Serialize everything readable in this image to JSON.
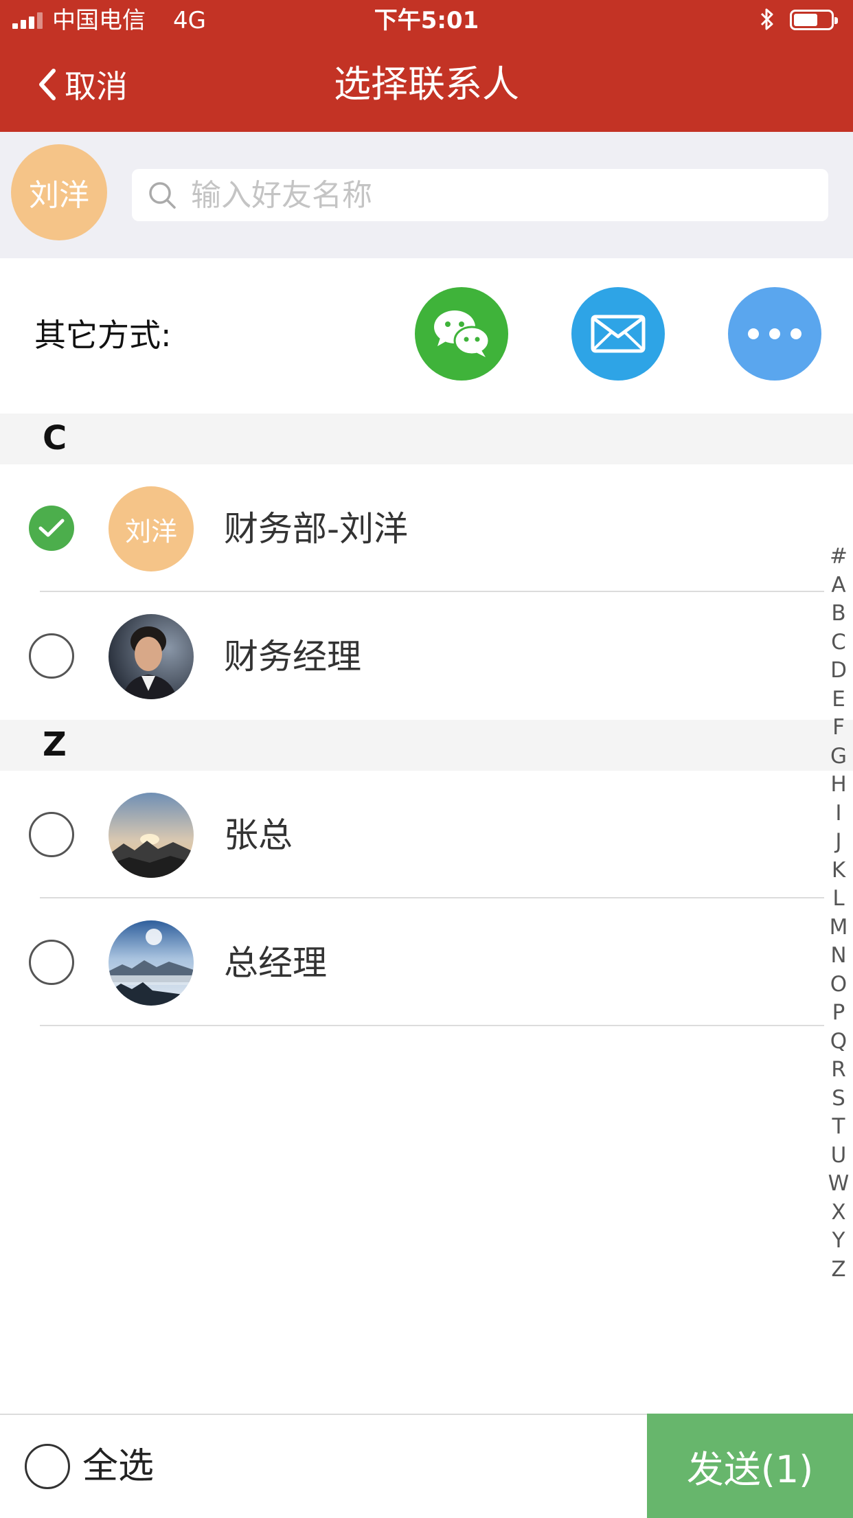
{
  "status_bar": {
    "carrier": "中国电信",
    "network": "4G",
    "time": "下午5:01"
  },
  "nav": {
    "back_label": "取消",
    "title": "选择联系人"
  },
  "current_user": {
    "avatar_text": "刘洋"
  },
  "search": {
    "placeholder": "输入好友名称",
    "value": ""
  },
  "other_methods": {
    "label": "其它方式:",
    "buttons": [
      {
        "icon": "wechat-icon",
        "color": "#3fb33a"
      },
      {
        "icon": "mail-icon",
        "color": "#2ea4e6"
      },
      {
        "icon": "more-icon",
        "color": "#5aa6ee"
      }
    ]
  },
  "sections": [
    {
      "letter": "C",
      "contacts": [
        {
          "name": "财务部-刘洋",
          "avatar_text": "刘洋",
          "selected": true
        },
        {
          "name": "财务经理",
          "avatar": "portrait-photo",
          "selected": false
        }
      ]
    },
    {
      "letter": "Z",
      "contacts": [
        {
          "name": "张总",
          "avatar": "sunset-mountain-photo",
          "selected": false
        },
        {
          "name": "总经理",
          "avatar": "misty-mountain-photo",
          "selected": false
        }
      ]
    }
  ],
  "index_letters": [
    "#",
    "A",
    "B",
    "C",
    "D",
    "E",
    "F",
    "G",
    "H",
    "I",
    "J",
    "K",
    "L",
    "M",
    "N",
    "O",
    "P",
    "Q",
    "R",
    "S",
    "T",
    "U",
    "W",
    "X",
    "Y",
    "Z"
  ],
  "footer": {
    "select_all_label": "全选",
    "send_label": "发送(1)"
  },
  "colors": {
    "header": "#c33325",
    "selected_check": "#4cae4c",
    "send_button": "#67b66c",
    "avatar_placeholder": "#f5c488"
  }
}
